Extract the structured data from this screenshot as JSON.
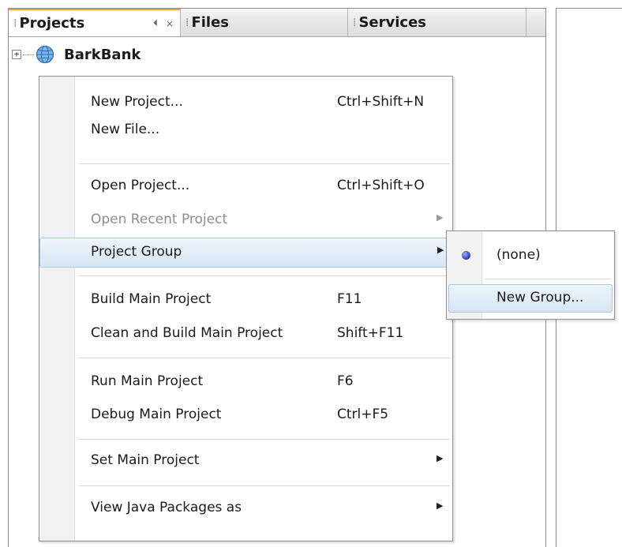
{
  "tabs": [
    {
      "label": "Projects",
      "active": true
    },
    {
      "label": "Files",
      "active": false
    },
    {
      "label": "Services",
      "active": false
    }
  ],
  "tab_controls": {
    "minimize_glyph": "⏴",
    "close_glyph": "×"
  },
  "tree": {
    "expander": "+",
    "root_label": "BarkBank",
    "root_icon": "globe-icon"
  },
  "menu": {
    "items": [
      {
        "label": "New Project...",
        "shortcut": "Ctrl+Shift+N"
      },
      {
        "label": "New File...",
        "shortcut": ""
      },
      {
        "label": "Open Project...",
        "shortcut": "Ctrl+Shift+O"
      },
      {
        "label": "Open Recent Project",
        "shortcut": "",
        "disabled": true,
        "submenu": true
      },
      {
        "label": "Project Group",
        "shortcut": "",
        "highlighted": true,
        "submenu": true
      },
      {
        "label": "Build Main Project",
        "shortcut": "F11"
      },
      {
        "label": "Clean and Build Main Project",
        "shortcut": "Shift+F11"
      },
      {
        "label": "Run Main Project",
        "shortcut": "F6"
      },
      {
        "label": "Debug Main Project",
        "shortcut": "Ctrl+F5"
      },
      {
        "label": "Set Main Project",
        "shortcut": "",
        "submenu": true
      },
      {
        "label": "View Java Packages as",
        "shortcut": "",
        "submenu": true
      }
    ],
    "arrow_glyph": "▶"
  },
  "submenu": {
    "items": [
      {
        "label": "(none)",
        "selected": true
      },
      {
        "label": "New Group...",
        "highlighted": true
      }
    ]
  },
  "colors": {
    "highlight_border": "#a9c6e3",
    "highlight_fill": "#d6e6f5",
    "active_tab_accent": "#f0a030",
    "disabled_text": "#8d8d8d"
  }
}
